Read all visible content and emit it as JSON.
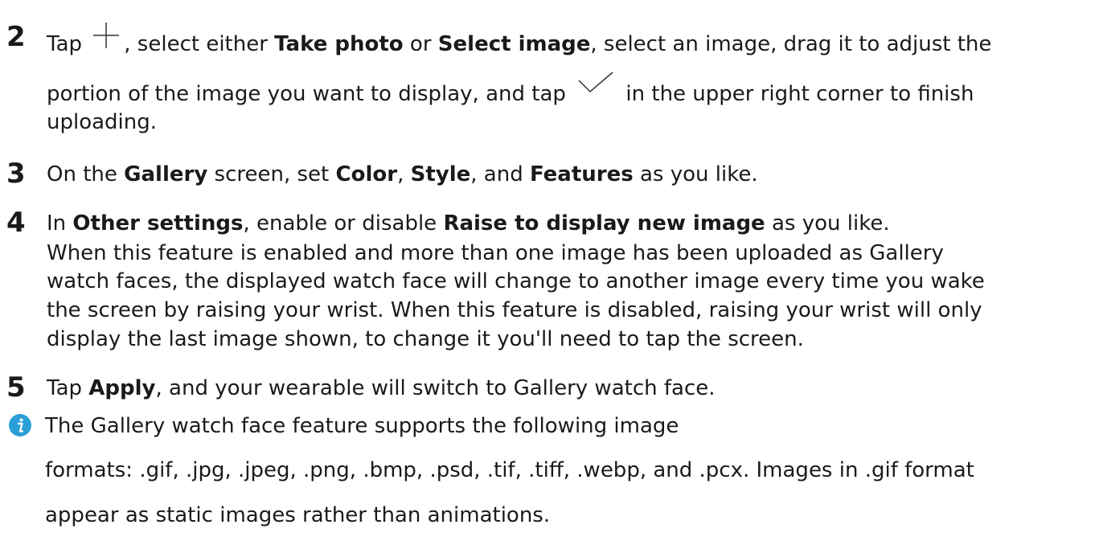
{
  "step2": {
    "number": "2",
    "t1": "Tap",
    "t2": ", select either",
    "b1": "Take photo",
    "t3": "or",
    "b2": "Select image",
    "t4": ", select an image, drag it to adjust the",
    "line2a": "portion of the image you want to display, and tap",
    "line2b": "in the upper right corner to finish",
    "line3": "uploading."
  },
  "step3": {
    "number": "3",
    "t1": "On the",
    "b1": "Gallery",
    "t2": "screen, set",
    "b2": "Color",
    "t3": ",",
    "b3": "Style",
    "t4": ", and",
    "b4": "Features",
    "t5": "as you like."
  },
  "step4": {
    "number": "4",
    "t1": "In",
    "b1": "Other settings",
    "t2": ", enable or disable",
    "b2": "Raise to display new image",
    "t3": "as you like.",
    "p1": "When this feature is enabled and more than one image has been uploaded as Gallery",
    "p2": "watch faces, the displayed watch face will change to another image every time you wake",
    "p3": "the screen by raising your wrist. When this feature is disabled, raising your wrist will only",
    "p4": "display the last image shown, to change it you'll need to tap the screen."
  },
  "step5": {
    "number": "5",
    "t1": "Tap",
    "b1": "Apply",
    "t2": ", and your wearable will switch to Gallery watch face."
  },
  "note": {
    "icon": "info-icon",
    "l1": "The Gallery watch face feature supports the following image",
    "l2": "formats: .gif, .jpg, .jpeg, .png, .bmp, .psd, .tif, .tiff, .webp, and .pcx. Images in .gif format",
    "l3": "appear as static images rather than animations."
  },
  "icons": {
    "add": "plus-icon",
    "confirm": "checkmark-icon",
    "info_color": "#2a9fd8"
  }
}
